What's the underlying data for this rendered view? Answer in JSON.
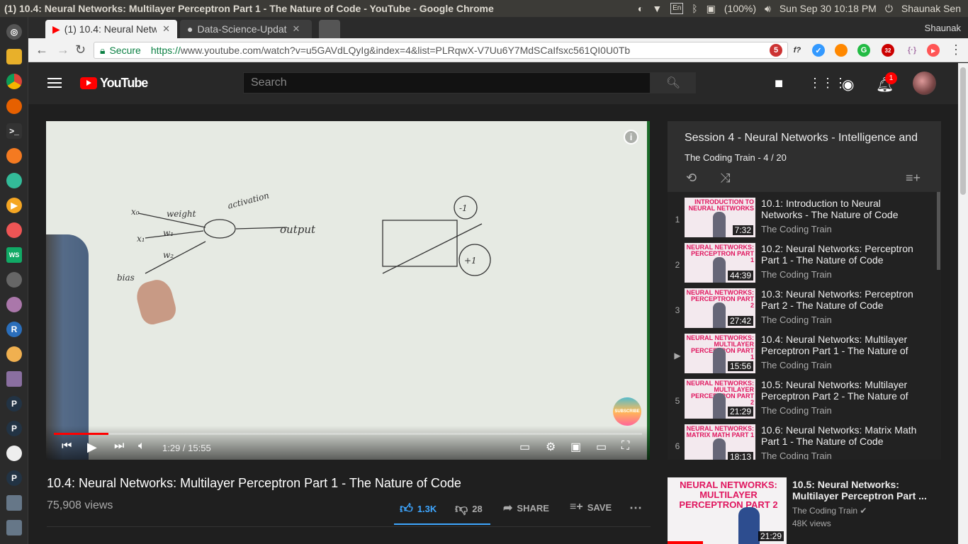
{
  "os": {
    "window_title": "(1) 10.4: Neural Networks: Multilayer Perceptron Part 1 - The Nature of Code - YouTube - Google Chrome",
    "keyboard": "En",
    "battery": "(100%)",
    "clock": "Sun Sep 30 10:18 PM",
    "user": "Shaunak Sen"
  },
  "browser": {
    "tabs": [
      {
        "label": "(1) 10.4: Neural Netw"
      },
      {
        "label": "Data-Science-Updat"
      }
    ],
    "profile": "Shaunak",
    "secure_label": "Secure",
    "url_protocol": "https://",
    "url_rest": "www.youtube.com/watch?v=u5GAVdLQyIg&index=4&list=PLRqwX-V7Uu6Y7MdSCaIfsxc561QI0U0Tb",
    "ext_badges": {
      "mail": "5",
      "abp": "32"
    }
  },
  "youtube": {
    "logo_text": "YouTube",
    "search_placeholder": "Search",
    "notification_count": "1",
    "player": {
      "current_time": "1:29",
      "duration": "15:55",
      "time_display": "1:29 / 15:55",
      "progress": 0.093,
      "subscribe_label": "SUBSCRIBE"
    },
    "video": {
      "title": "10.4: Neural Networks: Multilayer Perceptron Part 1 - The Nature of Code",
      "views": "75,908 views",
      "likes": "1.3K",
      "dislikes": "28",
      "share_label": "SHARE",
      "save_label": "SAVE"
    },
    "playlist": {
      "title": "Session 4 - Neural Networks - Intelligence and",
      "subtitle": "The Coding Train - 4 / 20",
      "items": [
        {
          "index": "1",
          "title": "10.1: Introduction to Neural Networks - The Nature of Code",
          "channel": "The Coding Train",
          "duration": "7:32",
          "thumb_text": "INTRODUCTION TO NEURAL NETWORKS"
        },
        {
          "index": "2",
          "title": "10.2: Neural Networks: Perceptron Part 1 - The Nature of Code",
          "channel": "The Coding Train",
          "duration": "44:39",
          "thumb_text": "NEURAL NETWORKS: PERCEPTRON PART 1"
        },
        {
          "index": "3",
          "title": "10.3: Neural Networks: Perceptron Part 2 - The Nature of Code",
          "channel": "The Coding Train",
          "duration": "27:42",
          "thumb_text": "NEURAL NETWORKS: PERCEPTRON PART 2"
        },
        {
          "index": "▶",
          "title": "10.4: Neural Networks: Multilayer Perceptron Part 1 - The Nature of",
          "channel": "The Coding Train",
          "duration": "15:56",
          "thumb_text": "NEURAL NETWORKS: MULTILAYER PERCEPTRON PART 1"
        },
        {
          "index": "5",
          "title": "10.5: Neural Networks: Multilayer Perceptron Part 2 - The Nature of",
          "channel": "The Coding Train",
          "duration": "21:29",
          "thumb_text": "NEURAL NETWORKS: MULTILAYER PERCEPTRON PART 2"
        },
        {
          "index": "6",
          "title": "10.6: Neural Networks: Matrix Math Part 1 - The Nature of Code",
          "channel": "The Coding Train",
          "duration": "18:13",
          "thumb_text": "NEURAL NETWORKS: MATRIX MATH PART 1"
        }
      ]
    },
    "up_next": {
      "title": "10.5: Neural Networks: Multilayer Perceptron Part ...",
      "channel": "The Coding Train",
      "views": "48K views",
      "duration": "21:29",
      "thumb_text": "NEURAL NETWORKS: MULTILAYER PERCEPTRON PART 2"
    }
  }
}
